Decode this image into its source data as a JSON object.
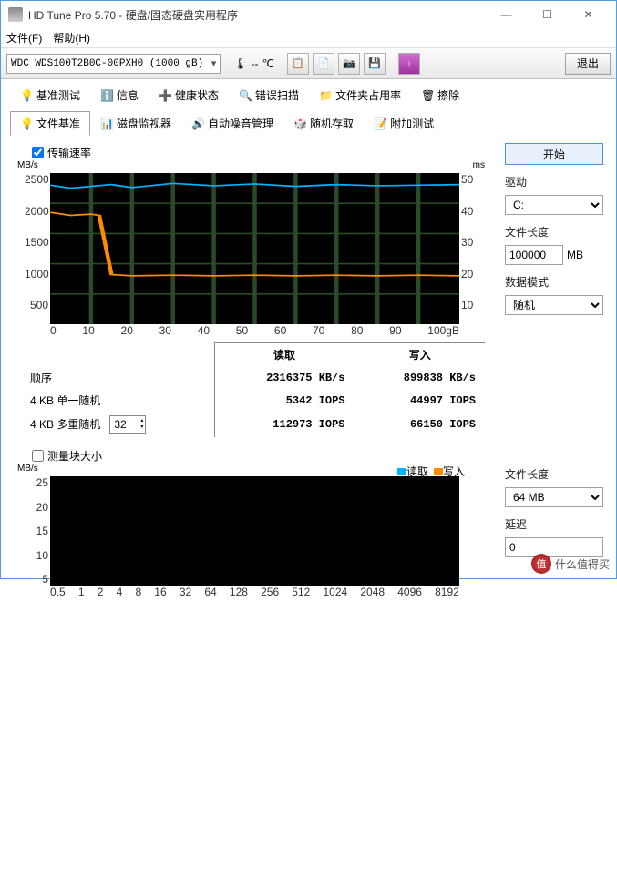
{
  "window": {
    "title": "HD Tune Pro 5.70 - 硬盘/固态硬盘实用程序"
  },
  "menu": {
    "file": "文件(F)",
    "help": "帮助(H)"
  },
  "toolbar": {
    "drive": "WDC WDS100T2B0C-00PXH0 (1000 gB)",
    "temp_value": "--",
    "temp_unit": "℃",
    "exit": "退出"
  },
  "tabs": {
    "row1": [
      "基准测试",
      "信息",
      "健康状态",
      "错误扫描",
      "文件夹占用率",
      "擦除"
    ],
    "row2": [
      "文件基准",
      "磁盘监视器",
      "自动噪音管理",
      "随机存取",
      "附加测试"
    ],
    "active": "文件基准"
  },
  "panel": {
    "transfer_chk": "传输速率",
    "blocksize_chk": "测量块大小",
    "start": "开始",
    "drive_lbl": "驱动",
    "drive_val": "C:",
    "filelen_lbl": "文件长度",
    "filelen_val": "100000",
    "filelen_unit": "MB",
    "datamode_lbl": "数据模式",
    "datamode_val": "随机",
    "filelen2_lbl": "文件长度",
    "filelen2_val": "64 MB",
    "delay_lbl": "延迟",
    "delay_val": "0"
  },
  "legend": {
    "read": "读取",
    "write": "写入"
  },
  "results": {
    "headers": [
      "",
      "读取",
      "写入"
    ],
    "rows": [
      {
        "label": "顺序",
        "read": "2316375 KB/s",
        "write": "899838 KB/s"
      },
      {
        "label": "4 KB 单一随机",
        "read": "5342 IOPS",
        "write": "44997 IOPS"
      },
      {
        "label": "4 KB 多重随机",
        "read": "112973 IOPS",
        "write": "66150 IOPS",
        "spin": "32"
      }
    ]
  },
  "chart_data": {
    "type": "line",
    "xlabel": "gB",
    "ylabel_left": "MB/s",
    "ylabel_right": "ms",
    "xlim": [
      0,
      100
    ],
    "ylim_left": [
      0,
      2500
    ],
    "ylim_right": [
      0,
      50
    ],
    "x_ticks": [
      0,
      10,
      20,
      30,
      40,
      50,
      60,
      70,
      80,
      90,
      "100gB"
    ],
    "y_ticks_left": [
      2500,
      2000,
      1500,
      1000,
      500
    ],
    "y_ticks_right": [
      50,
      40,
      30,
      20,
      10
    ],
    "series": [
      {
        "name": "读取",
        "color": "#00b4ff",
        "x": [
          0,
          5,
          10,
          15,
          20,
          30,
          40,
          50,
          60,
          70,
          80,
          90,
          100
        ],
        "values": [
          2300,
          2250,
          2280,
          2310,
          2260,
          2330,
          2290,
          2320,
          2280,
          2310,
          2290,
          2300,
          2310
        ]
      },
      {
        "name": "写入",
        "color": "#ff8c00",
        "x": [
          0,
          5,
          10,
          12,
          15,
          20,
          30,
          40,
          50,
          60,
          70,
          80,
          90,
          100
        ],
        "values": [
          1850,
          1800,
          1820,
          1800,
          820,
          800,
          810,
          800,
          810,
          800,
          810,
          800,
          810,
          800
        ]
      }
    ]
  },
  "chart2_data": {
    "type": "line",
    "ylabel": "MB/s",
    "y_ticks": [
      25,
      20,
      15,
      10,
      5
    ],
    "x_ticks": [
      "0.5",
      "1",
      "2",
      "4",
      "8",
      "16",
      "32",
      "64",
      "128",
      "256",
      "512",
      "1024",
      "2048",
      "4096",
      "8192"
    ],
    "series": []
  },
  "watermark": "什么值得买"
}
